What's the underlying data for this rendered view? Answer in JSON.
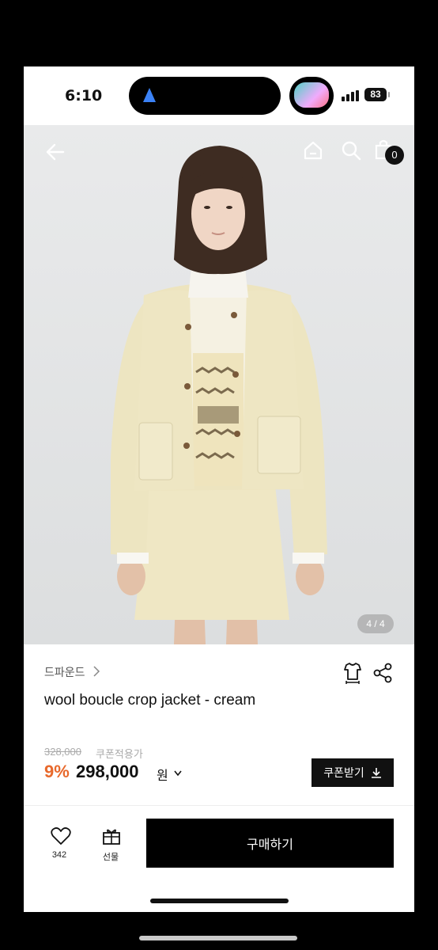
{
  "status_bar": {
    "time": "6:10",
    "battery": "83"
  },
  "product": {
    "brand": "드파운드",
    "title": "wool boucle crop jacket - cream",
    "original_price": "328,000",
    "coupon_note": "쿠폰적용가",
    "discount": "9%",
    "price": "298,000",
    "currency": "원",
    "image_counter": "4 / 4",
    "cart_count": "0"
  },
  "actions": {
    "coupon_button": "쿠폰받기",
    "like_count": "342",
    "gift_label": "선물",
    "buy_button": "구매하기"
  },
  "icons": {
    "back": "back-arrow-icon",
    "home": "home-icon",
    "search": "search-icon",
    "cart": "shopping-bag-icon",
    "size": "size-guide-icon",
    "share": "share-icon",
    "heart": "heart-icon",
    "gift": "gift-icon",
    "download": "download-icon"
  },
  "colors": {
    "accent": "#e8692c",
    "primary": "#000000",
    "jacket": "#ece4bd"
  }
}
